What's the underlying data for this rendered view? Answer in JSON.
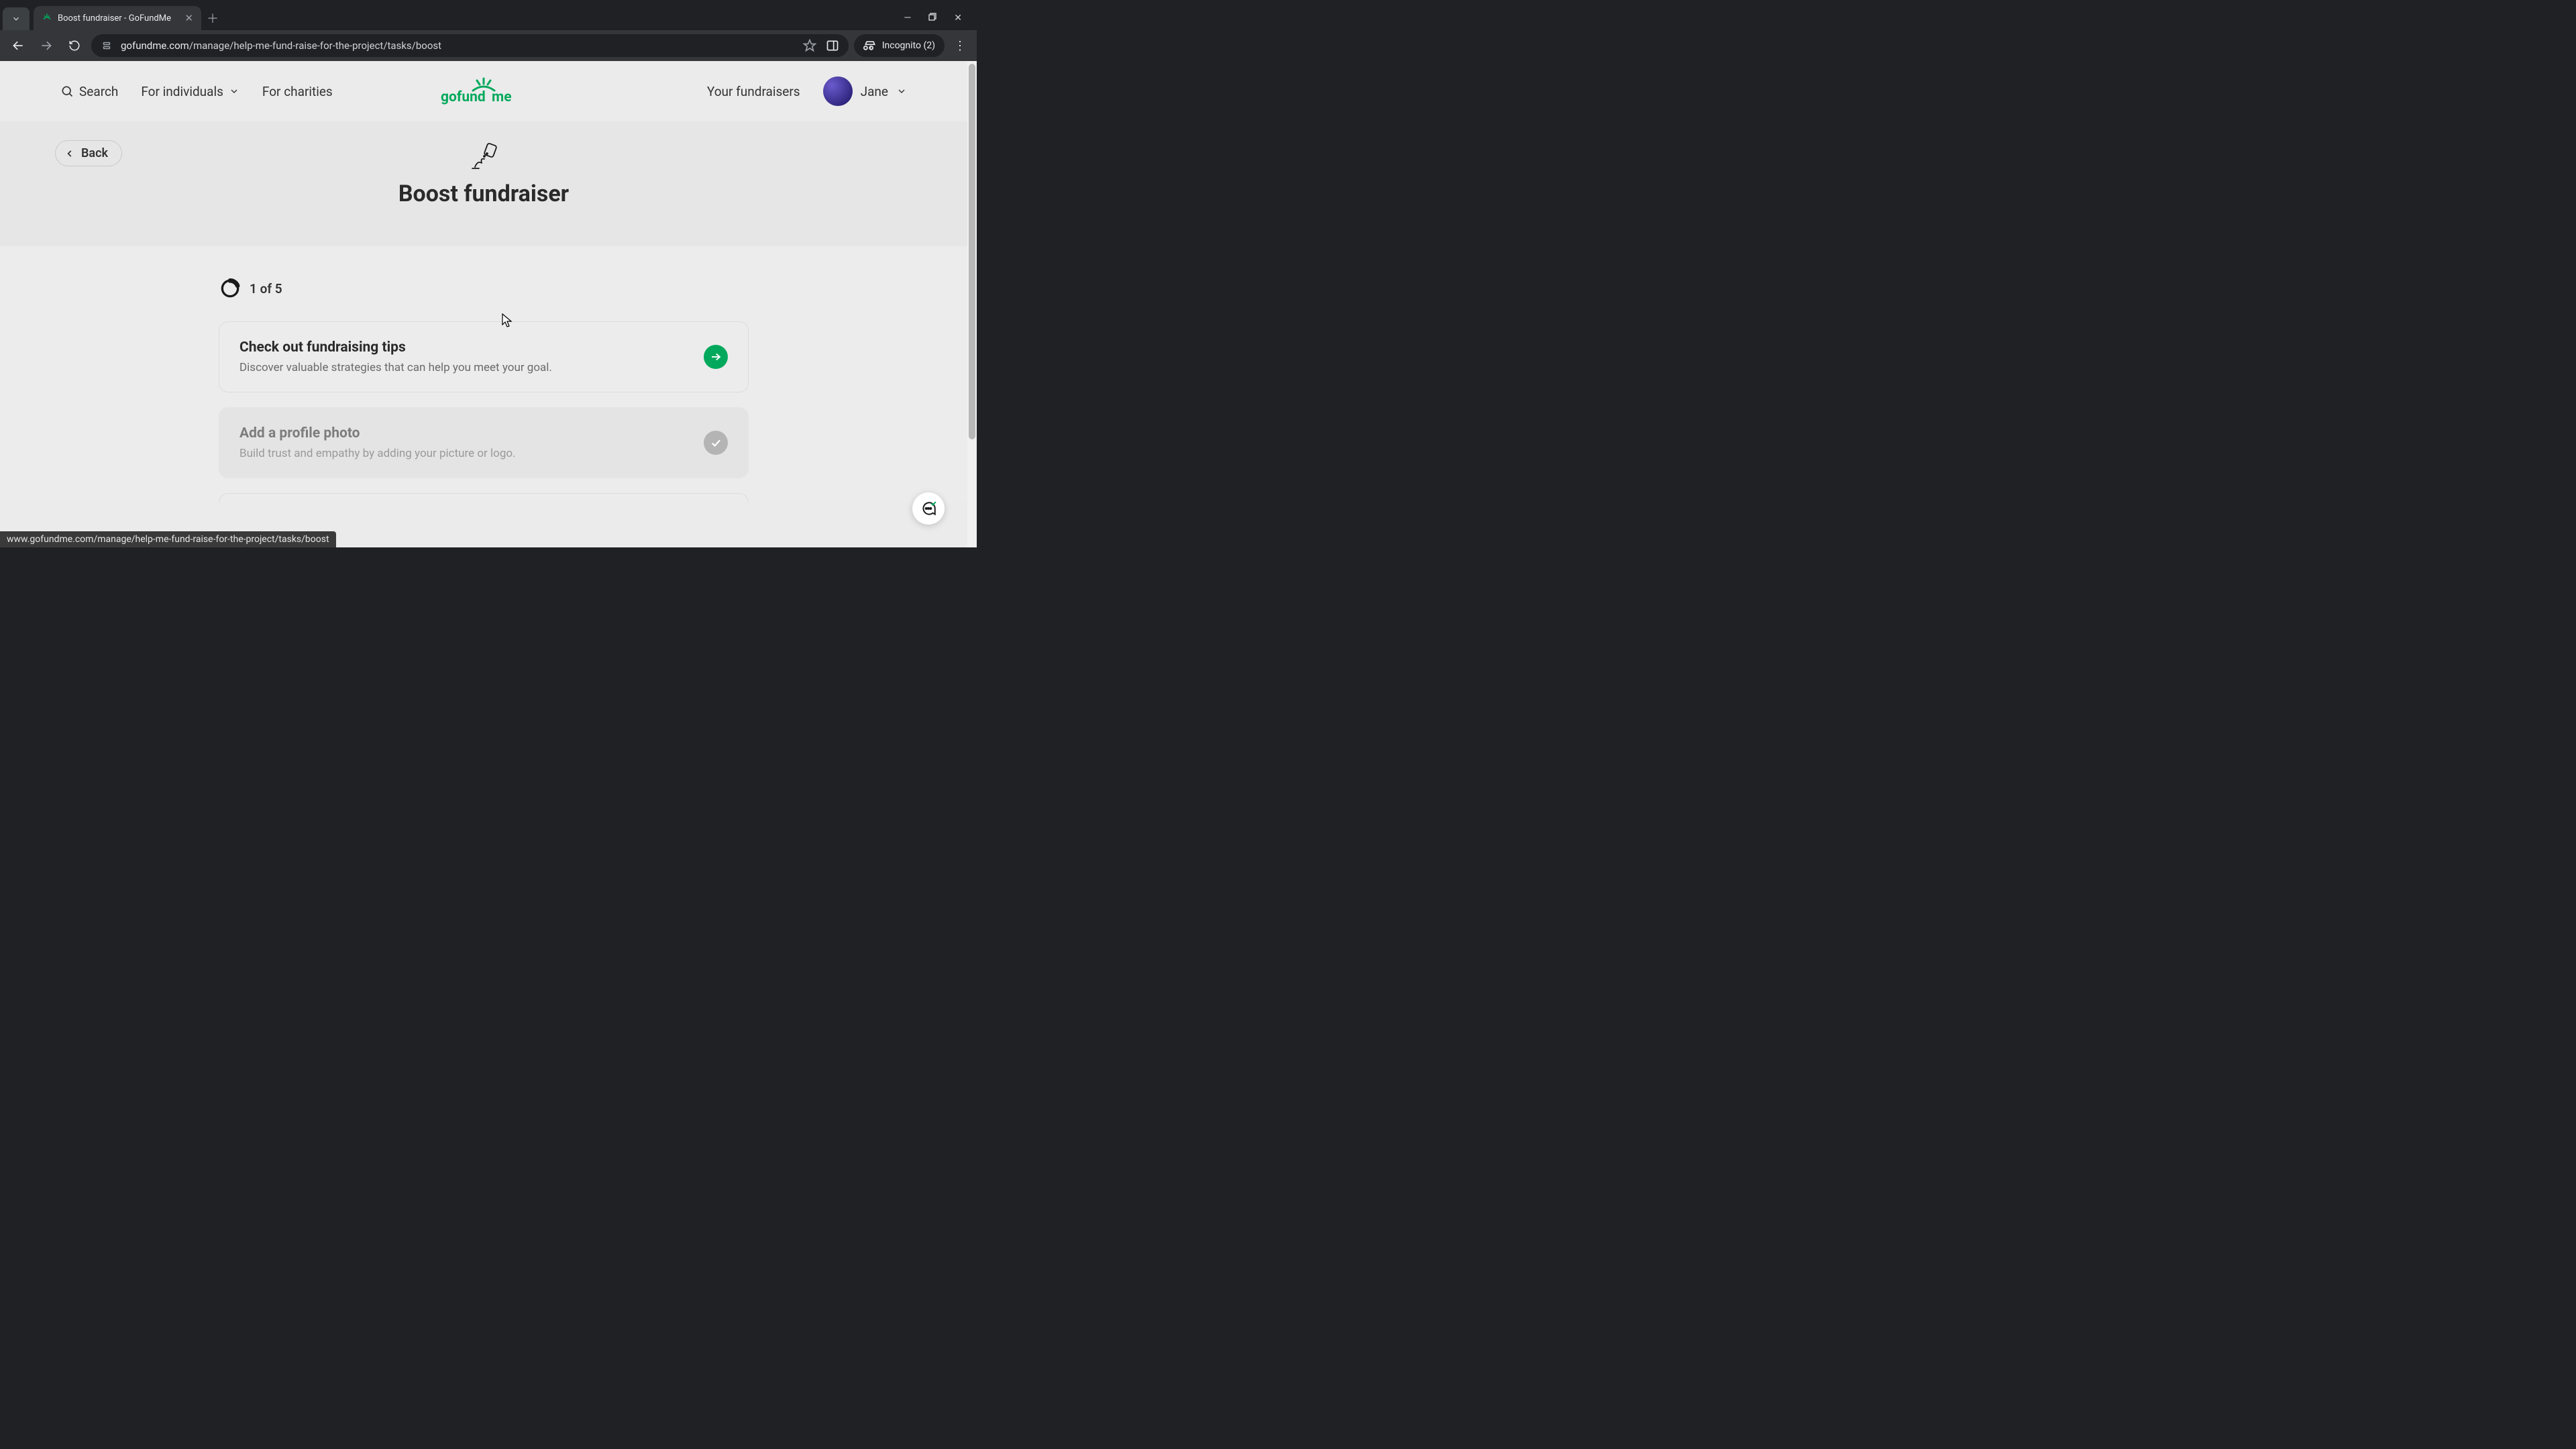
{
  "browser": {
    "tab_title": "Boost fundraiser - GoFundMe",
    "url_domain": "gofundme.com",
    "url_path": "/manage/help-me-fund-raise-for-the-project/tasks/boost",
    "incognito_label": "Incognito (2)"
  },
  "header": {
    "search": "Search",
    "for_individuals": "For individuals",
    "for_charities": "For charities",
    "your_fundraisers": "Your fundraisers",
    "user_name": "Jane"
  },
  "hero": {
    "back": "Back",
    "title": "Boost fundraiser"
  },
  "progress": {
    "label": "1 of 5",
    "completed": 1,
    "total": 5
  },
  "tasks": [
    {
      "title": "Check out fundraising tips",
      "desc": "Discover valuable strategies that can help you meet your goal.",
      "state": "todo"
    },
    {
      "title": "Add a profile photo",
      "desc": "Build trust and empathy by adding your picture or logo.",
      "state": "done"
    }
  ],
  "status_bar": "www.gofundme.com/manage/help-me-fund-raise-for-the-project/tasks/boost",
  "colors": {
    "brand_green": "#02a95c"
  }
}
